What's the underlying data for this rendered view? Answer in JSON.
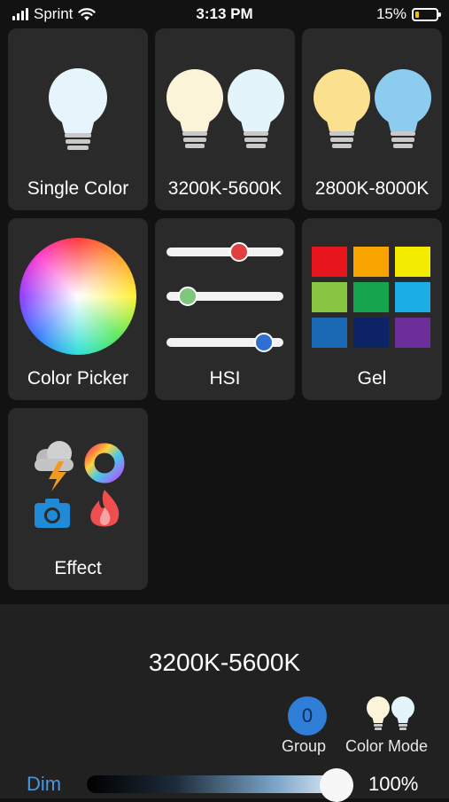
{
  "status": {
    "carrier": "Sprint",
    "time": "3:13 PM",
    "battery": "15%",
    "battery_level": 0.15
  },
  "tiles": [
    {
      "id": "single-color",
      "label": "Single Color"
    },
    {
      "id": "cct-3200-5600",
      "label": "3200K-5600K"
    },
    {
      "id": "cct-2800-8000",
      "label": "2800K-8000K"
    },
    {
      "id": "color-picker",
      "label": "Color Picker"
    },
    {
      "id": "hsi",
      "label": "HSI"
    },
    {
      "id": "gel",
      "label": "Gel"
    },
    {
      "id": "effect",
      "label": "Effect"
    }
  ],
  "hsi_sliders": [
    {
      "name": "hue",
      "color": "#e0403f",
      "level": 0.62
    },
    {
      "name": "saturation",
      "color": "#7ec77c",
      "level": 0.18
    },
    {
      "name": "intensity",
      "color": "#2f6fd1",
      "level": 0.83
    }
  ],
  "gel_colors": [
    "#e8161d",
    "#f7a400",
    "#f4ec00",
    "#88c540",
    "#16a44c",
    "#1aaee4",
    "#1b68b4",
    "#0c2366",
    "#6c2e9b"
  ],
  "bottom": {
    "current_mode": "3200K-5600K",
    "group_count": "0",
    "group_label": "Group",
    "color_mode_label": "Color Mode",
    "dim_label": "Dim",
    "dim_value": "100%",
    "dim_level": 1.0
  },
  "colors": {
    "accent": "#4a97e2",
    "tile_bg": "#2a2a2b",
    "panel_bg": "#212122"
  }
}
